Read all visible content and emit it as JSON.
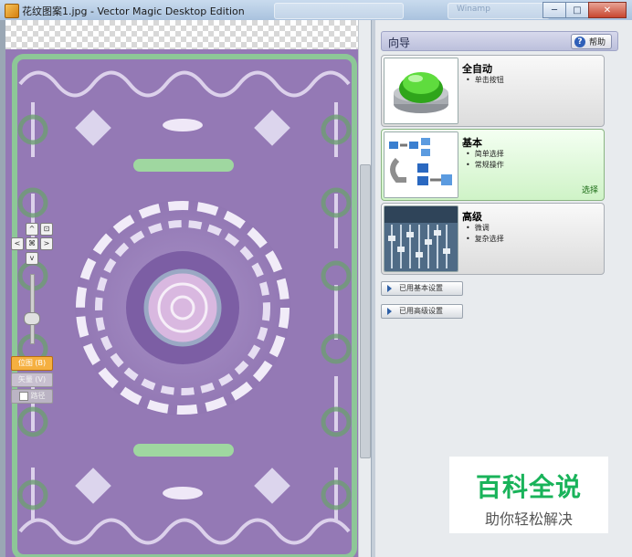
{
  "window": {
    "title": "花纹图案1.jpg - Vector Magic Desktop Edition",
    "background_title": "Winamp",
    "buttons": {
      "minimize": "─",
      "maximize": "□",
      "close": "✕"
    }
  },
  "canvas": {
    "nav": {
      "up": "^",
      "down": "v",
      "left": "<",
      "right": ">",
      "center": "⌘",
      "fit": "⊡"
    },
    "modes": {
      "bitmap": "位图 (B)",
      "vector": "矢量 (V)",
      "path": "路径"
    }
  },
  "wizard": {
    "title": "向导",
    "help_label": "帮助",
    "options": [
      {
        "title": "全自动",
        "items": [
          "单击按钮"
        ],
        "icon": "green-button-icon"
      },
      {
        "title": "基本",
        "items": [
          "简单选择",
          "常规操作"
        ],
        "select_label": "选择",
        "icon": "flowchart-icon"
      },
      {
        "title": "高级",
        "items": [
          "微调",
          "复杂选择"
        ],
        "icon": "mixer-icon"
      }
    ],
    "settings": {
      "basic": "已用基本设置",
      "advanced": "已用高级设置"
    }
  },
  "watermark": {
    "main": "百科全说",
    "sub": "助你轻松解决"
  },
  "colors": {
    "accent": "#19b35a",
    "pattern_purple": "#9578b5",
    "mode_active": "#f5b040"
  }
}
